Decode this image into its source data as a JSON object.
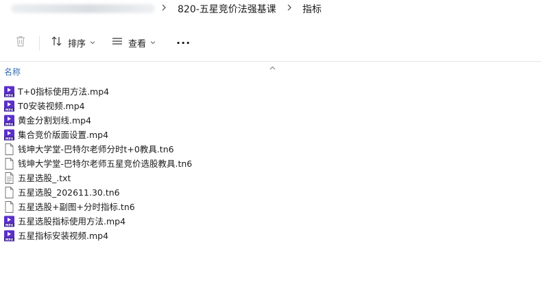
{
  "breadcrumb": {
    "items": [
      "820-五星竞价法强基课",
      "指标"
    ]
  },
  "toolbar": {
    "sort_label": "排序",
    "view_label": "查看",
    "more_label": "···"
  },
  "columns": {
    "name_header": "名称"
  },
  "files": [
    {
      "name": "T+0指标使用方法.mp4",
      "type": "mp4"
    },
    {
      "name": "T0安装视频.mp4",
      "type": "mp4"
    },
    {
      "name": "黄金分割划线.mp4",
      "type": "mp4"
    },
    {
      "name": "集合竞价版面设置.mp4",
      "type": "mp4"
    },
    {
      "name": "钱坤大学堂-巴特尔老师分时t+0教具.tn6",
      "type": "tn6"
    },
    {
      "name": "钱坤大学堂-巴特尔老师五星竞价选股教具.tn6",
      "type": "tn6"
    },
    {
      "name": "五星选股_.txt",
      "type": "txt"
    },
    {
      "name": "五星选股_202611.30.tn6",
      "type": "tn6"
    },
    {
      "name": "五星选股+副图+分时指标.tn6",
      "type": "tn6"
    },
    {
      "name": "五星选股指标使用方法.mp4",
      "type": "mp4"
    },
    {
      "name": "五星指标安装视频.mp4",
      "type": "mp4"
    }
  ],
  "colors": {
    "video_icon": "#5b2fc9",
    "link_header": "#3a6fb0"
  }
}
